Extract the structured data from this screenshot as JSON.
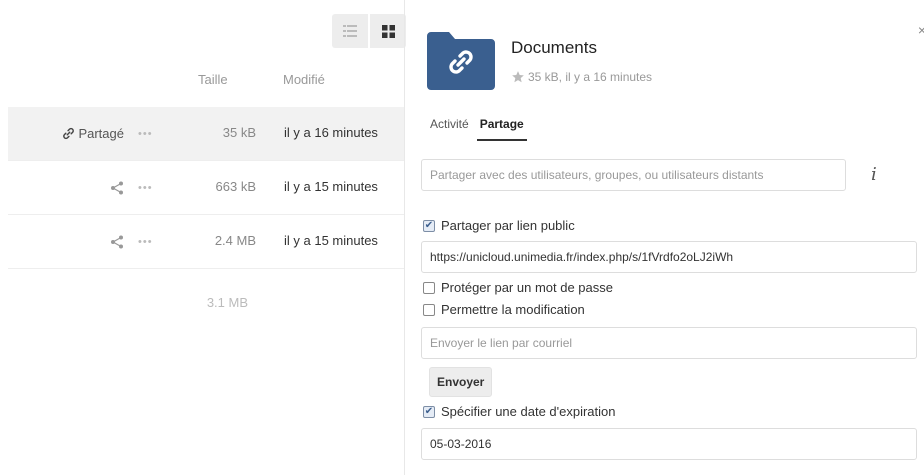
{
  "file_list": {
    "columns": {
      "size": "Taille",
      "modified": "Modifié"
    },
    "rows": [
      {
        "share_label": "Partagé",
        "more": "•••",
        "size": "35 kB",
        "modified": "il y a 16 minutes",
        "shared": true
      },
      {
        "share_label": "",
        "more": "•••",
        "size": "663 kB",
        "modified": "il y a 15 minutes",
        "shared": false
      },
      {
        "share_label": "",
        "more": "•••",
        "size": "2.4 MB",
        "modified": "il y a 15 minutes",
        "shared": false
      }
    ],
    "total_size": "3.1 MB"
  },
  "panel": {
    "close": "×",
    "title": "Documents",
    "meta": "35 kB, il y a 16 minutes",
    "tabs": [
      "Activité",
      "Partage"
    ],
    "share_with_placeholder": "Partager avec des utilisateurs, groupes, ou utilisateurs distants",
    "info_icon": "i",
    "public_link_label": "Partager par lien public",
    "public_link_checked": true,
    "link_url": "https://unicloud.unimedia.fr/index.php/s/1fVrdfo2oLJ2iWh",
    "password_label": "Protéger par un mot de passe",
    "allow_edit_label": "Permettre la modification",
    "email_placeholder": "Envoyer le lien par courriel",
    "send_label": "Envoyer",
    "expiration_label": "Spécifier une date d'expiration",
    "expiration_checked": true,
    "expiration_date": "05-03-2016"
  },
  "colors": {
    "folder": "#3a5f8f",
    "accent_text": "#222222",
    "muted_text": "#999999"
  },
  "icons": {
    "list_view": "list-view-icon",
    "grid_view": "grid-view-icon",
    "link": "link-icon",
    "share": "share-icon",
    "star": "star-icon",
    "folder": "shared-folder-icon"
  }
}
